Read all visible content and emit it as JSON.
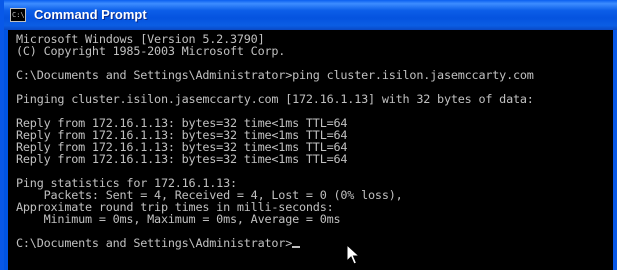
{
  "window": {
    "title": "Command Prompt",
    "icon": "cmd-icon",
    "icon_glyph": "C:\\"
  },
  "console": {
    "lines": [
      "Microsoft Windows [Version 5.2.3790]",
      "(C) Copyright 1985-2003 Microsoft Corp.",
      "",
      "C:\\Documents and Settings\\Administrator>ping cluster.isilon.jasemccarty.com",
      "",
      "Pinging cluster.isilon.jasemccarty.com [172.16.1.13] with 32 bytes of data:",
      "",
      "Reply from 172.16.1.13: bytes=32 time<1ms TTL=64",
      "Reply from 172.16.1.13: bytes=32 time<1ms TTL=64",
      "Reply from 172.16.1.13: bytes=32 time<1ms TTL=64",
      "Reply from 172.16.1.13: bytes=32 time<1ms TTL=64",
      "",
      "Ping statistics for 172.16.1.13:",
      "    Packets: Sent = 4, Received = 4, Lost = 0 (0% loss),",
      "Approximate round trip times in milli-seconds:",
      "    Minimum = 0ms, Maximum = 0ms, Average = 0ms",
      "",
      "C:\\Documents and Settings\\Administrator>"
    ]
  },
  "colors": {
    "console_background": "#000000",
    "console_text": "#c0c0c0",
    "titlebar": "#0054e3"
  }
}
